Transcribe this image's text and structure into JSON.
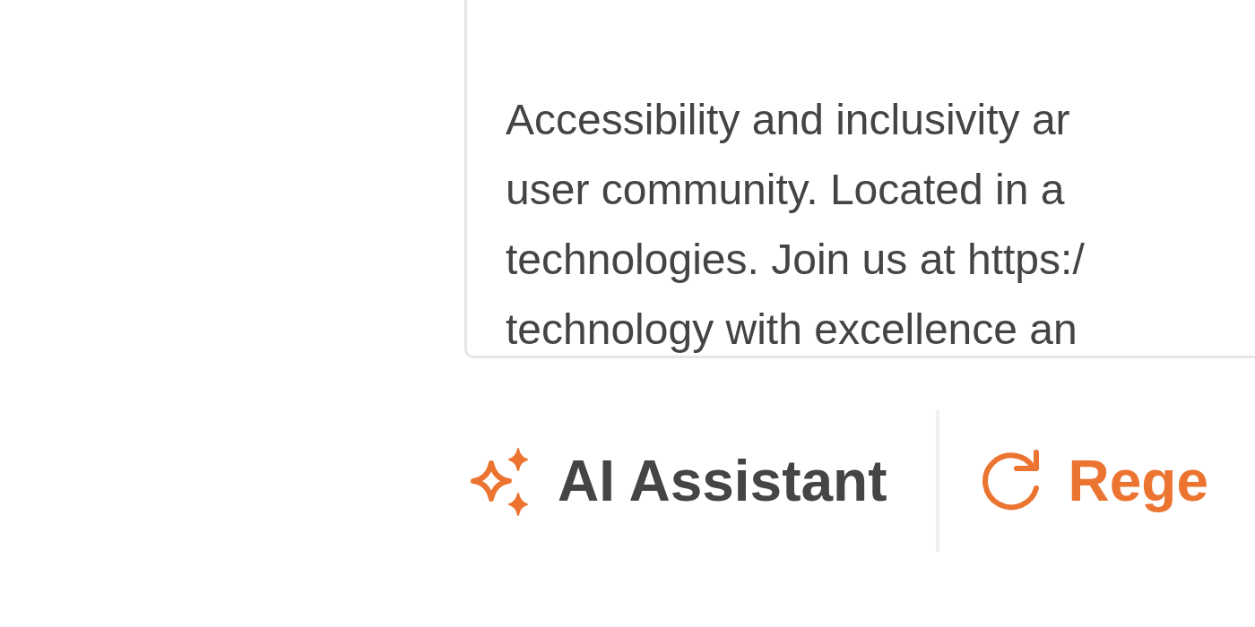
{
  "text_card": {
    "lines": [
      "Accessibility and inclusivity ar",
      "user community. Located in a",
      "technologies. Join us at https:/",
      "technology with excellence an"
    ]
  },
  "toolbar": {
    "assistant": {
      "label": "AI Assistant"
    },
    "regenerate": {
      "label": "Rege"
    }
  }
}
